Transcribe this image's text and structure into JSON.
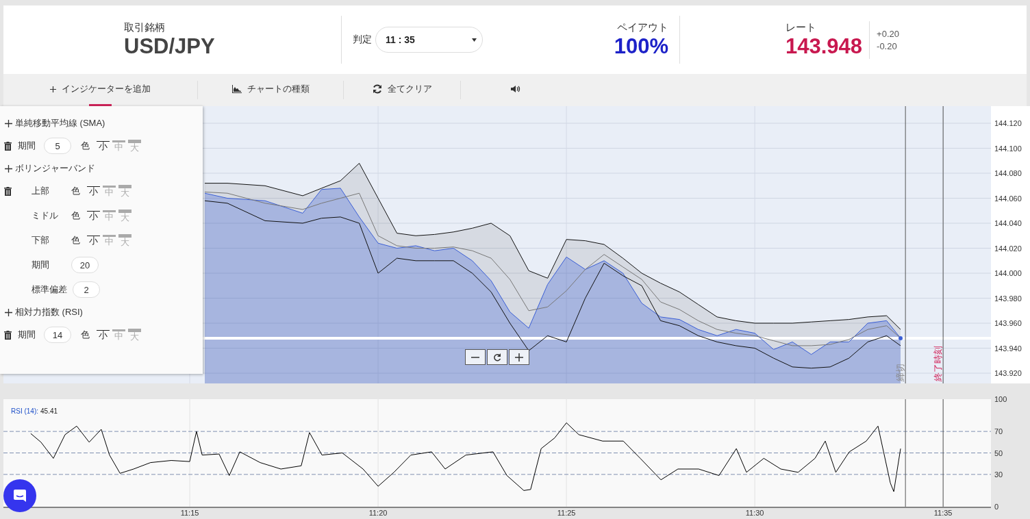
{
  "header": {
    "symbol_label": "取引銘柄",
    "symbol": "USD/JPY",
    "expiry_label": "判定",
    "expiry": "11 : 35",
    "payout_label": "ペイアウト",
    "payout": "100%",
    "rate_label": "レート",
    "rate": "143.948",
    "spread_up": "+0.20",
    "spread_down": "-0.20"
  },
  "toolbar": [
    {
      "kind": "add",
      "label": "インジケーターを追加",
      "selected": true
    },
    {
      "kind": "chart-type",
      "label": "チャートの種類",
      "selected": false
    },
    {
      "kind": "clear",
      "label": "全てクリア",
      "selected": false
    },
    {
      "kind": "sound",
      "selected": false
    }
  ],
  "indicator_panel": {
    "sections": [
      {
        "title": "単純移動平均線 (SMA)",
        "rows": [
          {
            "label": "期間",
            "value": "5",
            "color_label": "色",
            "widths": [
              {
                "label": "小",
                "selected": true
              },
              {
                "label": "中",
                "selected": false
              },
              {
                "label": "大",
                "selected": false
              }
            ]
          }
        ]
      },
      {
        "title": "ボリンジャーバンド",
        "rows": [
          {
            "label": "上部",
            "color_label": "色",
            "widths": [
              {
                "label": "小",
                "selected": true
              },
              {
                "label": "中",
                "selected": false
              },
              {
                "label": "大",
                "selected": false
              }
            ]
          },
          {
            "label": "ミドル",
            "color_label": "色",
            "widths": [
              {
                "label": "小",
                "selected": true
              },
              {
                "label": "中",
                "selected": false
              },
              {
                "label": "大",
                "selected": false
              }
            ]
          },
          {
            "label": "下部",
            "color_label": "色",
            "widths": [
              {
                "label": "小",
                "selected": true
              },
              {
                "label": "中",
                "selected": false
              },
              {
                "label": "大",
                "selected": false
              }
            ]
          },
          {
            "label": "期間",
            "value": "20"
          },
          {
            "label": "標準偏差",
            "value": "2"
          }
        ]
      },
      {
        "title": "相対力指数 (RSI)",
        "rows": [
          {
            "label": "期間",
            "value": "14",
            "color_label": "色",
            "widths": [
              {
                "label": "小",
                "selected": true
              },
              {
                "label": "中",
                "selected": false
              },
              {
                "label": "大",
                "selected": false
              }
            ]
          }
        ]
      }
    ]
  },
  "price_chart": {
    "chart_data": {
      "type": "area",
      "grid": true,
      "x": [
        675.4,
        676,
        677,
        678,
        678.5,
        679,
        679.5,
        680,
        680.5,
        681,
        681.5,
        682,
        682.5,
        683,
        683.5,
        684,
        684.5,
        685,
        685.5,
        686,
        686.5,
        687,
        687.5,
        688,
        688.5,
        689,
        689.5,
        690,
        690.5,
        691,
        691.5,
        692,
        692.5,
        693,
        693.5,
        693.87
      ],
      "series": [
        {
          "color": "#3b5fd6",
          "values": [
            144.064,
            144.06,
            144.058,
            144.048,
            144.067,
            144.068,
            144.045,
            144.024,
            144.02,
            144.022,
            144.018,
            144.02,
            144.01,
            143.994,
            143.969,
            143.956,
            143.991,
            144.013,
            144.003,
            144.01,
            144.0,
            143.976,
            143.965,
            143.963,
            143.955,
            143.95,
            143.955,
            143.952,
            143.939,
            143.945,
            143.935,
            143.945,
            143.945,
            143.96,
            143.962,
            143.948
          ]
        },
        {
          "type": "area",
          "color": "#111111",
          "values": [
            144.072,
            144.072,
            144.07,
            144.062,
            144.068,
            144.074,
            144.088,
            144.06,
            144.032,
            144.03,
            144.031,
            144.033,
            144.036,
            144.04,
            144.03,
            144.002,
            143.996,
            144.027,
            144.026,
            144.023,
            144.012,
            144.0,
            143.992,
            143.985,
            143.975,
            143.965,
            143.962,
            143.96,
            143.96,
            143.96,
            143.961,
            143.962,
            143.963,
            143.965,
            143.966,
            143.955
          ]
        },
        {
          "type": "line",
          "color": "#777777",
          "values": [
            144.065,
            144.064,
            144.056,
            144.051,
            144.056,
            144.06,
            144.064,
            144.03,
            144.022,
            144.02,
            144.02,
            144.021,
            144.018,
            144.012,
            143.995,
            143.97,
            143.973,
            143.986,
            144.003,
            144.015,
            144.005,
            143.995,
            143.977,
            143.971,
            143.962,
            143.955,
            143.952,
            143.95,
            143.946,
            143.942,
            143.942,
            143.943,
            143.947,
            143.955,
            143.958,
            143.948
          ]
        },
        {
          "type": "line",
          "color": "#111111",
          "values": [
            144.058,
            144.056,
            144.042,
            144.04,
            144.044,
            144.045,
            144.04,
            144.0,
            144.012,
            144.01,
            144.01,
            144.01,
            144.0,
            143.985,
            143.96,
            143.938,
            143.95,
            143.945,
            143.98,
            144.008,
            143.998,
            143.99,
            143.962,
            143.958,
            143.95,
            143.945,
            143.942,
            143.94,
            143.932,
            143.925,
            143.924,
            143.925,
            143.932,
            143.945,
            143.95,
            143.942
          ]
        }
      ],
      "xlim": [
        670,
        696.27
      ],
      "ylim": [
        143.9118,
        144.1337
      ],
      "yticks": [
        {
          "value": 143.92,
          "label": "143.920"
        },
        {
          "value": 143.94,
          "label": "143.940"
        },
        {
          "value": 143.96,
          "label": "143.960"
        },
        {
          "value": 143.98,
          "label": "143.980"
        },
        {
          "value": 144.0,
          "label": "144.000"
        },
        {
          "value": 144.02,
          "label": "144.020"
        },
        {
          "value": 144.04,
          "label": "144.040"
        },
        {
          "value": 144.06,
          "label": "144.060"
        },
        {
          "value": 144.08,
          "label": "144.080"
        },
        {
          "value": 144.1,
          "label": "144.100"
        },
        {
          "value": 144.12,
          "label": "144.120"
        }
      ],
      "ref_lines": [
        {
          "axis": "x",
          "value": 694,
          "label": "締切"
        },
        {
          "axis": "x",
          "value": 695,
          "label": "終了時刻"
        },
        {
          "axis": "y",
          "value": 143.948
        }
      ]
    }
  },
  "rsi_panel": {
    "label": "RSI (14):",
    "value": "45.41",
    "chart_data": {
      "type": "line",
      "grid": true,
      "ref_lines": [
        {
          "axis": "x",
          "value": 694
        },
        {
          "axis": "x",
          "value": 695
        }
      ],
      "x": [
        670.78,
        671.05,
        671.38,
        671.69,
        672.0,
        672.33,
        672.65,
        672.87,
        673.15,
        673.51,
        673.96,
        674.51,
        675.0,
        675.18,
        675.33,
        675.78,
        676.05,
        676.33,
        676.87,
        677.42,
        677.96,
        678.18,
        678.51,
        679.05,
        679.6,
        680.0,
        680.42,
        680.87,
        681.42,
        681.78,
        682.33,
        683.05,
        683.42,
        683.87,
        684.05,
        684.33,
        684.69,
        685.0,
        685.33,
        685.96,
        686.51,
        686.96,
        687.51,
        687.96,
        688.51,
        689.05,
        689.51,
        689.78,
        690.24,
        690.69,
        691.15,
        691.6,
        691.87,
        692.15,
        692.51,
        692.96,
        693.27,
        693.42,
        693.6,
        693.69,
        693.87
      ],
      "series": [
        {
          "color": "#000000",
          "values": [
            68,
            60,
            45,
            67,
            75,
            60,
            72,
            48,
            31,
            35,
            41,
            43,
            42,
            70,
            48,
            49,
            29,
            51,
            41,
            35,
            38,
            69,
            48,
            50,
            35,
            19,
            32,
            48,
            51,
            35,
            48,
            51,
            29,
            15,
            16,
            54,
            64,
            78,
            67,
            61,
            61,
            45,
            25,
            35,
            35,
            29,
            54,
            32,
            45,
            35,
            32,
            45,
            61,
            32,
            51,
            61,
            75,
            51,
            22,
            14,
            54
          ]
        }
      ],
      "xlim": [
        670,
        696.27
      ],
      "ylim": [
        0,
        100
      ],
      "yticks": [
        0,
        30,
        50,
        70,
        100
      ],
      "xticks": [
        {
          "value": 675,
          "label": "11:15"
        },
        {
          "value": 680,
          "label": "11:20"
        },
        {
          "value": 685,
          "label": "11:25"
        },
        {
          "value": 690,
          "label": "11:30"
        },
        {
          "value": 695,
          "label": "11:35"
        }
      ]
    }
  }
}
